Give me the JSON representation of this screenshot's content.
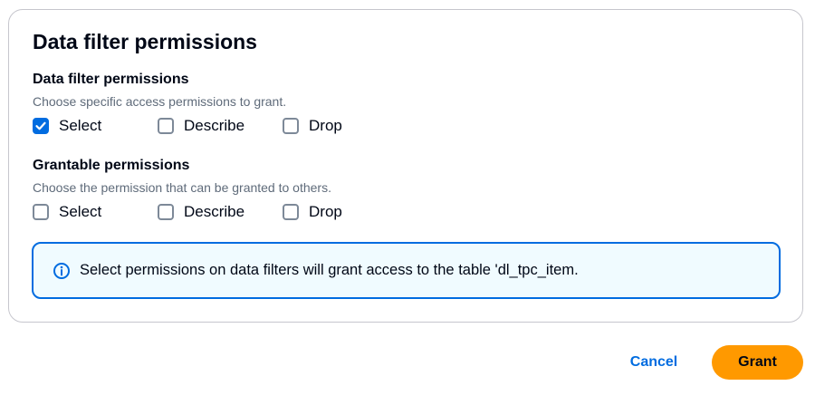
{
  "panel": {
    "title": "Data filter permissions"
  },
  "data_filter_permissions": {
    "title": "Data filter permissions",
    "description": "Choose specific access permissions to grant.",
    "options": [
      {
        "label": "Select",
        "checked": true
      },
      {
        "label": "Describe",
        "checked": false
      },
      {
        "label": "Drop",
        "checked": false
      }
    ]
  },
  "grantable_permissions": {
    "title": "Grantable permissions",
    "description": "Choose the permission that can be granted to others.",
    "options": [
      {
        "label": "Select",
        "checked": false
      },
      {
        "label": "Describe",
        "checked": false
      },
      {
        "label": "Drop",
        "checked": false
      }
    ]
  },
  "info_alert": {
    "icon": "info-icon",
    "text": "Select permissions on data filters will grant access to the table 'dl_tpc_item."
  },
  "footer": {
    "cancel_label": "Cancel",
    "grant_label": "Grant"
  },
  "colors": {
    "accent": "#006ce0",
    "grant_button": "#ff9900",
    "info_background": "#f0fbff",
    "muted_text": "#5f6b7a"
  }
}
